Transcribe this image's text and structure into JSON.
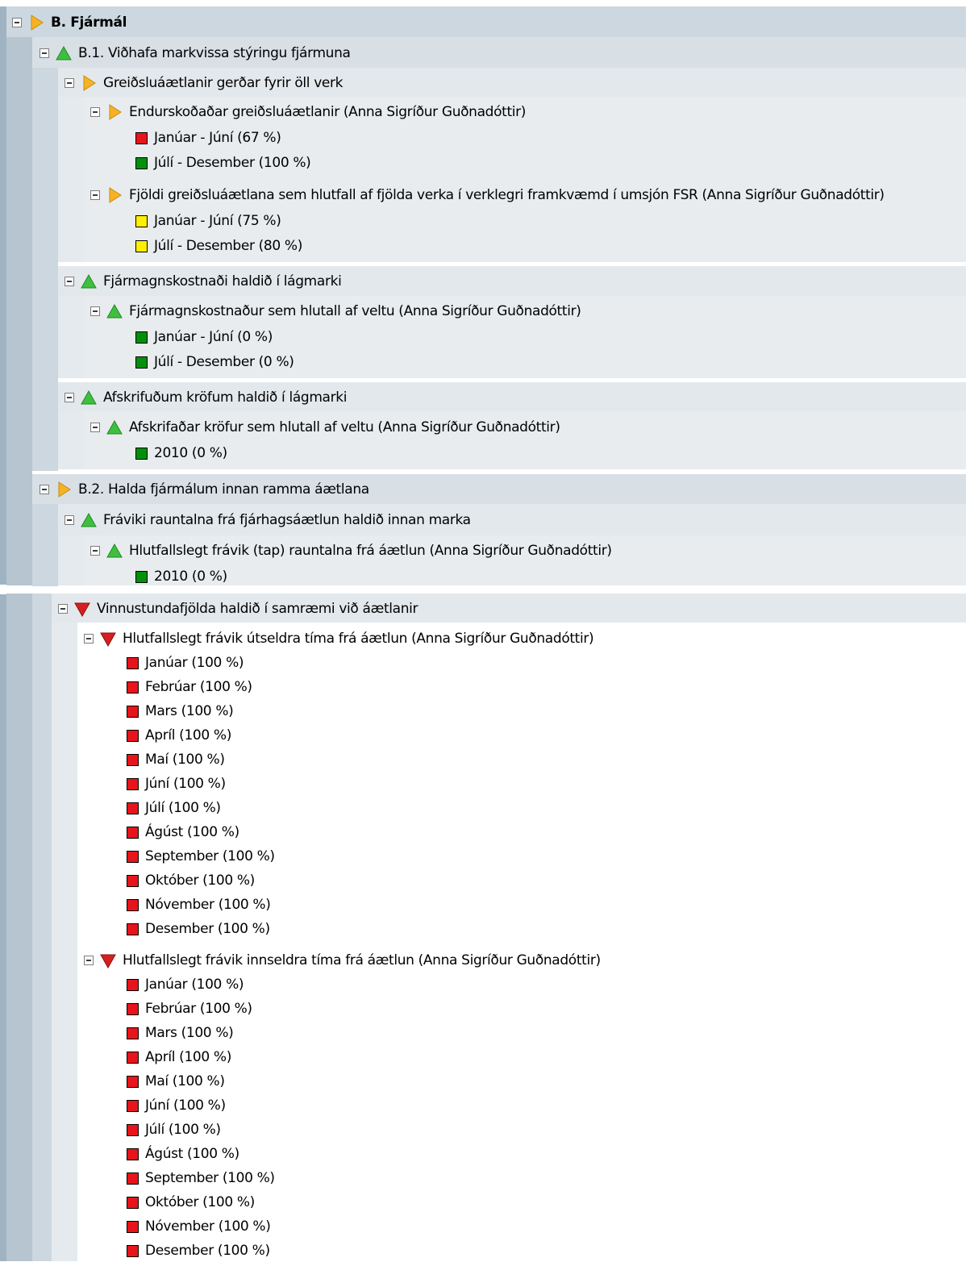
{
  "colors": {
    "red": "#e8141b",
    "green": "#00900c",
    "yellow": "#fff000",
    "arrow_orange": "#f5b323",
    "triangle_green": "#3fbf3f",
    "triangle_red": "#d62020"
  },
  "tree": {
    "root": {
      "label": "B. Fjármál",
      "icon": "orange-arrow-icon"
    },
    "b1": {
      "label": "B.1. Viðhafa markvissa stýringu fjármuna",
      "icon": "green-triangle-icon",
      "g1": {
        "label": "Greiðsluáætlanir gerðar fyrir öll verk",
        "icon": "orange-arrow-icon",
        "k1": {
          "label": "Endurskoðaðar greiðsluáætlanir (Anna Sigríður Guðnadóttir)",
          "icon": "orange-arrow-icon",
          "items": [
            {
              "label": "Janúar - Júní (67 %)",
              "status": "red"
            },
            {
              "label": "Júlí - Desember (100 %)",
              "status": "green"
            }
          ]
        },
        "k2": {
          "label": "Fjöldi greiðsluáætlana sem hlutfall af fjölda verka í verklegri framkvæmd í umsjón FSR (Anna Sigríður Guðnadóttir)",
          "icon": "orange-arrow-icon",
          "items": [
            {
              "label": "Janúar - Júní (75 %)",
              "status": "yellow"
            },
            {
              "label": "Júlí - Desember (80 %)",
              "status": "yellow"
            }
          ]
        }
      },
      "g2": {
        "label": "Fjármagnskostnaði haldið í lágmarki",
        "icon": "green-triangle-icon",
        "k1": {
          "label": "Fjármagnskostnaður sem hlutall af veltu (Anna Sigríður Guðnadóttir)",
          "icon": "green-triangle-icon",
          "items": [
            {
              "label": "Janúar - Júní (0 %)",
              "status": "green"
            },
            {
              "label": "Júlí - Desember (0 %)",
              "status": "green"
            }
          ]
        }
      },
      "g3": {
        "label": "Afskrifuðum kröfum haldið í lágmarki",
        "icon": "green-triangle-icon",
        "k1": {
          "label": "Afskrifaðar kröfur sem hlutall af veltu (Anna Sigríður Guðnadóttir)",
          "icon": "green-triangle-icon",
          "items": [
            {
              "label": "2010 (0 %)",
              "status": "green"
            }
          ]
        }
      }
    },
    "b2": {
      "label": "B.2. Halda fjármálum innan ramma áætlana",
      "icon": "orange-arrow-icon",
      "g1": {
        "label": "Fráviki rauntalna frá fjárhagsáætlun haldið innan marka",
        "icon": "green-triangle-icon",
        "k1": {
          "label": "Hlutfallslegt frávik (tap) rauntalna frá áætlun (Anna Sigríður Guðnadóttir)",
          "icon": "green-triangle-icon",
          "items": [
            {
              "label": "2010 (0 %)",
              "status": "green"
            }
          ]
        }
      }
    },
    "g_vinn": {
      "label": "Vinnustundafjölda haldið í samræmi við áætlanir",
      "icon": "red-down-triangle-icon",
      "k1": {
        "label": "Hlutfallslegt frávik útseldra tíma frá áætlun (Anna Sigríður Guðnadóttir)",
        "icon": "red-down-triangle-icon",
        "items": [
          {
            "label": "Janúar (100 %)",
            "status": "red"
          },
          {
            "label": "Febrúar (100 %)",
            "status": "red"
          },
          {
            "label": "Mars (100 %)",
            "status": "red"
          },
          {
            "label": "Apríl (100 %)",
            "status": "red"
          },
          {
            "label": "Maí (100 %)",
            "status": "red"
          },
          {
            "label": "Júní (100 %)",
            "status": "red"
          },
          {
            "label": "Júlí (100 %)",
            "status": "red"
          },
          {
            "label": "Ágúst (100 %)",
            "status": "red"
          },
          {
            "label": "September (100 %)",
            "status": "red"
          },
          {
            "label": "Október (100 %)",
            "status": "red"
          },
          {
            "label": "Nóvember (100 %)",
            "status": "red"
          },
          {
            "label": "Desember (100 %)",
            "status": "red"
          }
        ]
      },
      "k2": {
        "label": "Hlutfallslegt frávik innseldra tíma frá áætlun (Anna Sigríður Guðnadóttir)",
        "icon": "red-down-triangle-icon",
        "items": [
          {
            "label": "Janúar (100 %)",
            "status": "red"
          },
          {
            "label": "Febrúar (100 %)",
            "status": "red"
          },
          {
            "label": "Mars (100 %)",
            "status": "red"
          },
          {
            "label": "Apríl (100 %)",
            "status": "red"
          },
          {
            "label": "Maí (100 %)",
            "status": "red"
          },
          {
            "label": "Júní (100 %)",
            "status": "red"
          },
          {
            "label": "Júlí (100 %)",
            "status": "red"
          },
          {
            "label": "Ágúst (100 %)",
            "status": "red"
          },
          {
            "label": "September (100 %)",
            "status": "red"
          },
          {
            "label": "Október (100 %)",
            "status": "red"
          },
          {
            "label": "Nóvember (100 %)",
            "status": "red"
          },
          {
            "label": "Desember (100 %)",
            "status": "red"
          }
        ]
      }
    }
  }
}
